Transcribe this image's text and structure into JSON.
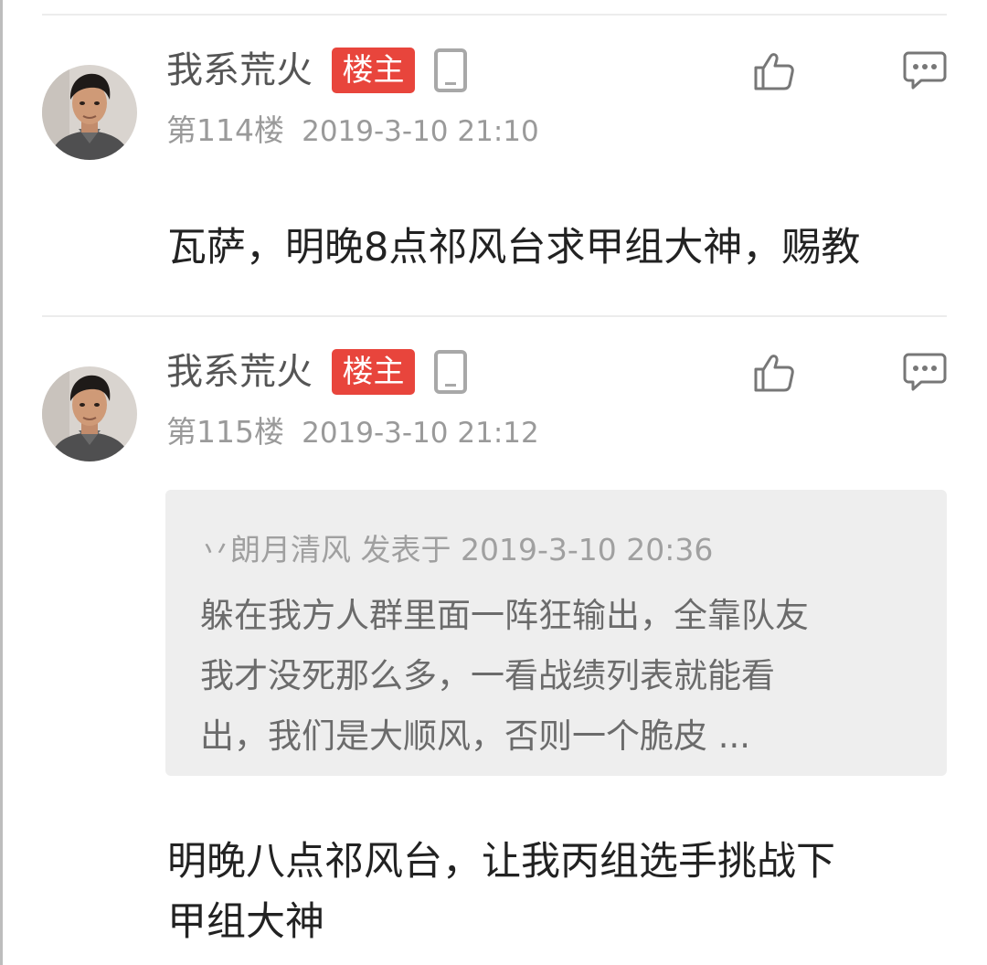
{
  "posts": [
    {
      "username": "我系荒火",
      "badge": "楼主",
      "floor": "第114楼",
      "date": "2019-3-10 21:10",
      "content": "瓦萨，明晚8点祁风台求甲组大神，赐教"
    },
    {
      "username": "我系荒火",
      "badge": "楼主",
      "floor": "第115楼",
      "date": "2019-3-10 21:12",
      "quote": {
        "header": "丷朗月清风 发表于 2019-3-10 20:36",
        "lines": [
          "躲在我方人群里面一阵狂输出，全靠队友",
          "我才没死那么多，一看战绩列表就能看",
          "出，我们是大顺风，否则一个脆皮 ..."
        ]
      },
      "content_lines": [
        "明晚八点祁风台，让我丙组选手挑战下",
        "甲组大神"
      ]
    }
  ],
  "icons": {
    "avatar": "avatar",
    "phone": "phone-icon",
    "like": "thumbs-up-icon",
    "reply": "comment-icon"
  },
  "colors": {
    "badge": "#e8453c",
    "username": "#555555",
    "meta": "#9a9a9a",
    "content": "#222222",
    "quote_bg": "#eeeeee"
  }
}
